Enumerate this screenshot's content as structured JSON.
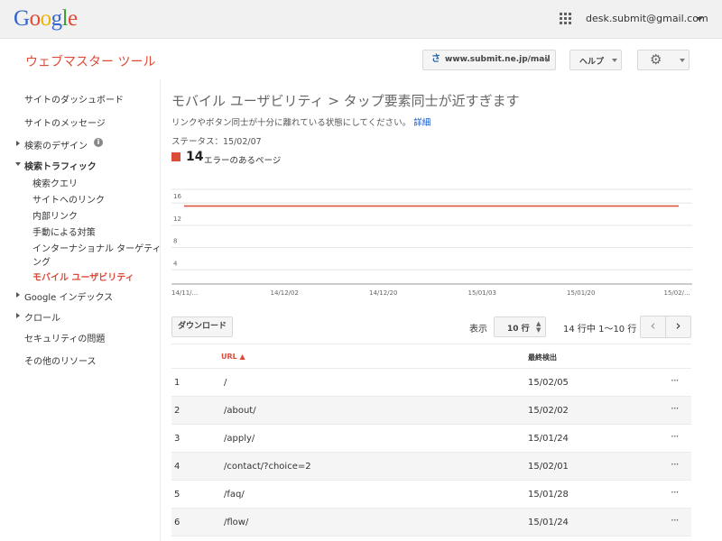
{
  "topbar": {
    "logo": [
      "G",
      "o",
      "o",
      "g",
      "l",
      "e"
    ],
    "logo_colors": [
      "#3366cc",
      "#dd4b39",
      "#f0b400",
      "#3366cc",
      "#3c9a3c",
      "#dd4b39"
    ],
    "apps_icon": "apps-grid-icon",
    "account": "desk.submit@gmail.com"
  },
  "header": {
    "product_title": "ウェブマスター ツール",
    "site": "www.submit.ne.jp/mail",
    "site_icon_glyph": "さ",
    "help_label": "ヘルプ",
    "settings_icon": "gear-icon"
  },
  "sidebar": {
    "dashboard": "サイトのダッシュボード",
    "messages": "サイトのメッセージ",
    "search_appearance": "検索のデザイン",
    "search_traffic": "検索トラフィック",
    "traffic_items": [
      "検索クエリ",
      "サイトへのリンク",
      "内部リンク",
      "手動による対策",
      "インターナショナル ターゲティ",
      "ング",
      "モバイル ユーザビリティ"
    ],
    "google_index": "Google インデックス",
    "crawl": "クロール",
    "security": "セキュリティの問題",
    "other_resources": "その他のリソース"
  },
  "main": {
    "page_title": "モバイル ユーザビリティ > タップ要素同士が近すぎます",
    "description": "リンクやボタン同士が十分に離れている状態にしてください。",
    "details_link": "詳細",
    "status": "ステータス：15/02/07",
    "error_count": "14",
    "error_label": "エラーのあるページ",
    "accent_color": "#dd4b39"
  },
  "chart_data": {
    "type": "line",
    "series": [
      {
        "values": [
          14,
          14,
          14,
          14,
          14,
          14,
          14,
          14,
          14,
          14,
          14,
          14,
          14,
          14,
          14,
          14,
          14,
          14,
          14,
          14,
          14,
          14,
          14,
          14,
          14,
          14,
          14,
          14,
          14,
          14,
          14,
          14,
          14,
          14,
          14,
          14,
          14,
          14,
          14,
          14,
          14,
          14,
          14,
          14,
          14,
          14,
          14,
          14,
          14,
          14,
          14,
          14,
          14,
          14,
          14,
          14,
          14,
          14,
          14,
          14,
          14,
          14,
          14,
          14,
          14,
          14,
          14,
          14,
          14,
          14,
          14,
          14,
          14,
          14,
          14,
          14,
          14,
          14,
          14,
          14,
          14,
          14,
          14,
          14,
          14,
          14,
          14
        ]
      }
    ],
    "x_tick_labels": [
      "14/11/...",
      "14/12/02",
      "14/12/20",
      "15/01/03",
      "15/01/20",
      "15/02/..."
    ],
    "y_tick_labels": [
      "16",
      "12",
      "8",
      "4"
    ],
    "y_ticks": [
      16,
      12,
      8,
      4
    ],
    "ylim": [
      0,
      17
    ],
    "grid": true
  },
  "table_controls": {
    "download": "ダウンロード",
    "show_label": "表示",
    "rows_per_page": "10 行",
    "range": "14 行中 1〜10 行",
    "prev": "‹",
    "next": "›"
  },
  "table": {
    "headers": {
      "url": "URL ▲",
      "last_detected": "最終検出"
    },
    "rows": [
      {
        "num": "1",
        "url": "/",
        "date": "15/02/05"
      },
      {
        "num": "2",
        "url": "/about/",
        "date": "15/02/02"
      },
      {
        "num": "3",
        "url": "/apply/",
        "date": "15/01/24"
      },
      {
        "num": "4",
        "url": "/contact/?choice=2",
        "date": "15/02/01"
      },
      {
        "num": "5",
        "url": "/faq/",
        "date": "15/01/28"
      },
      {
        "num": "6",
        "url": "/flow/",
        "date": "15/01/24"
      }
    ],
    "more_glyph": "···"
  }
}
